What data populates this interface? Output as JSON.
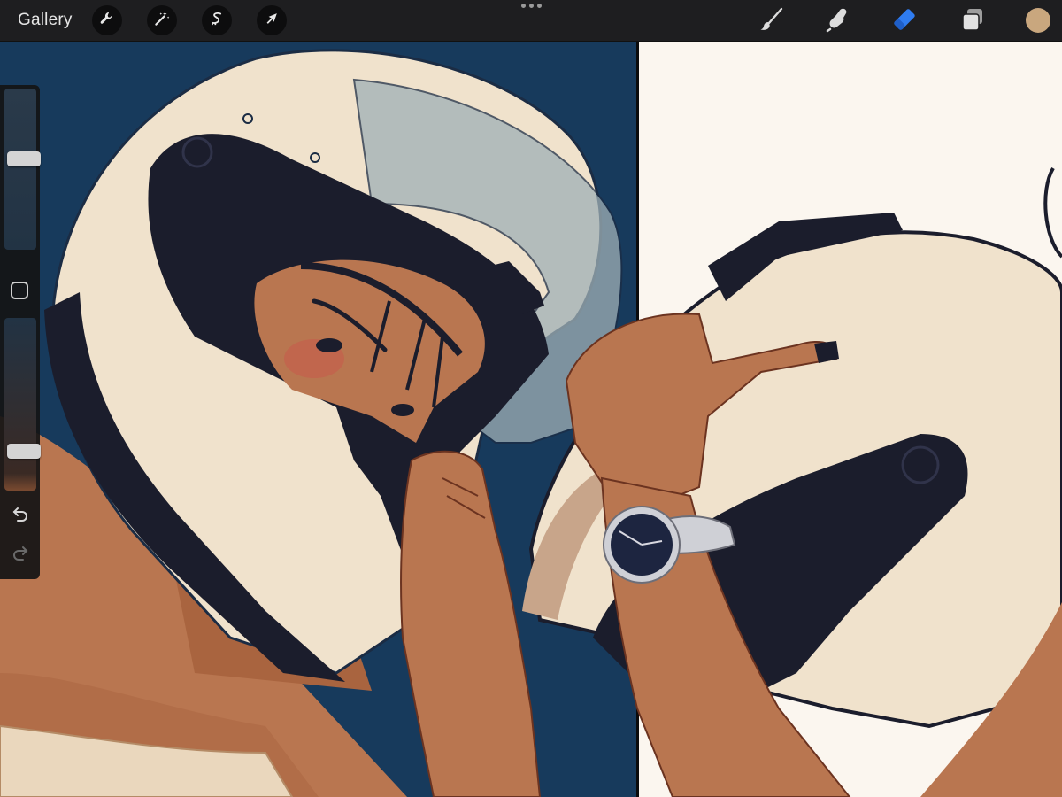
{
  "topbar": {
    "gallery_label": "Gallery",
    "left_tools": [
      {
        "name": "actions",
        "icon": "wrench-icon"
      },
      {
        "name": "adjustments",
        "icon": "magic-wand-icon"
      },
      {
        "name": "selection",
        "icon": "selection-s-icon"
      },
      {
        "name": "transform",
        "icon": "arrow-cursor-icon"
      }
    ],
    "more_icon": "more-dots-icon",
    "right_tools": [
      {
        "name": "brush",
        "icon": "brush-icon",
        "active": false
      },
      {
        "name": "smudge",
        "icon": "smudge-finger-icon",
        "active": false
      },
      {
        "name": "eraser",
        "icon": "eraser-icon",
        "active": true
      },
      {
        "name": "layers",
        "icon": "layers-icon",
        "active": false
      }
    ],
    "current_color": "#c9a77e"
  },
  "sidebar": {
    "brush_size_level": 0.57,
    "brush_opacity_level": 0.2,
    "modify_icon": "square-modify-icon",
    "undo_icon": "undo-icon",
    "redo_icon": "redo-icon",
    "redo_enabled": false
  },
  "colors": {
    "accent_eraser": "#2f7cf0",
    "panel_left_bg": "#173a5c",
    "panel_right_bg": "#fbf6ef",
    "helmet_shell": "#f0e2cc",
    "helmet_dark": "#1b1d2c",
    "skin": "#b97650",
    "skin_shadow": "#9a5a3c",
    "visor": "#9fb0b6",
    "watch": "#cfd0d6",
    "watch_face": "#1d2540",
    "tank_top": "#ead7bd"
  }
}
